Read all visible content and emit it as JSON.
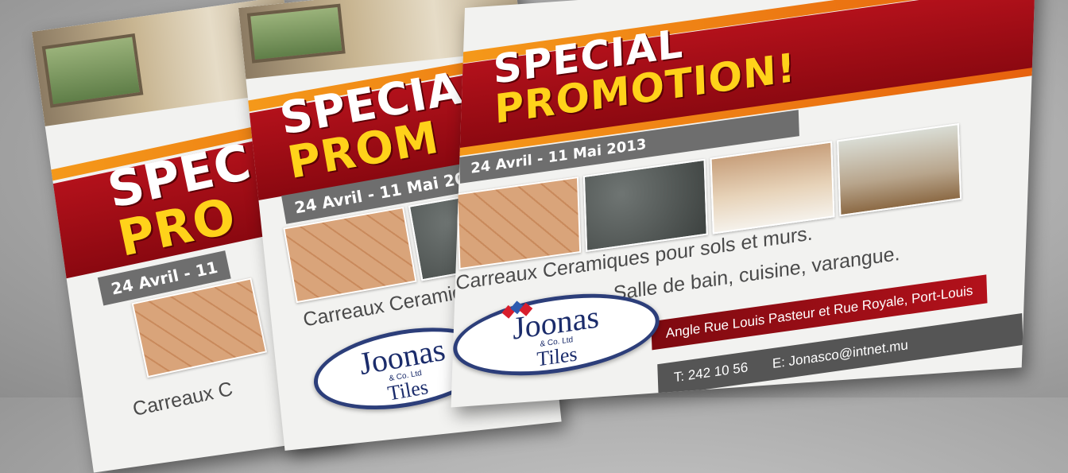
{
  "flyer": {
    "title_line1": "SPECIAL",
    "title_line2": "PROMOTION!",
    "back1_title_line1": "SPEC",
    "back1_title_line2": "PRO",
    "back2_title_line1": "SPECIA",
    "back2_title_line2": "PROM",
    "dates": "24 Avril - 11 Mai 2013",
    "back1_dates": "24 Avril - 11",
    "back2_dates": "24 Avril - 11 Mai 20",
    "tagline_1": "Carreaux Ceramiques pour sols et murs.",
    "tagline_2": "Salle de bain, cuisine, varangue.",
    "back1_tagline": "Carreaux C",
    "back2_tagline": "Carreaux Ceramiq",
    "address": "Angle Rue Louis Pasteur et Rue Royale, Port-Louis",
    "phone": "T: 242 10 56",
    "email": "E: Jonasco@intnet.mu"
  },
  "logo": {
    "name": "Joonas",
    "suffix": "& Co. Ltd",
    "product": "Tiles"
  },
  "colors": {
    "red": "#b3111b",
    "yellow": "#ffd21a",
    "orange": "#f59a1a",
    "grey_bar": "#6e6e6e",
    "logo_blue": "#2c3e7a"
  },
  "icons": [
    "tile-photo",
    "logo-diamond-mark"
  ]
}
